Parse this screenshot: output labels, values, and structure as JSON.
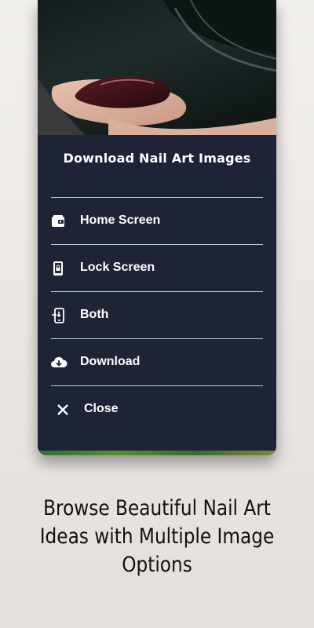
{
  "sheet": {
    "title": "Download Nail Art Images",
    "items": [
      {
        "label": "Home Screen",
        "icon": "wallet-icon"
      },
      {
        "label": "Lock Screen",
        "icon": "lock-phone-icon"
      },
      {
        "label": "Both",
        "icon": "phone-transfer-icon"
      },
      {
        "label": "Download",
        "icon": "cloud-download-icon"
      },
      {
        "label": "Close",
        "icon": "close-icon"
      }
    ]
  },
  "caption": {
    "line1": "Browse Beautiful Nail Art",
    "line2": "Ideas with Multiple Image",
    "line3": "Options"
  },
  "colors": {
    "sheet_background": "#1e2336",
    "text": "#ffffff",
    "divider": "#c9ccd6",
    "page_background": "#ece9e6"
  }
}
